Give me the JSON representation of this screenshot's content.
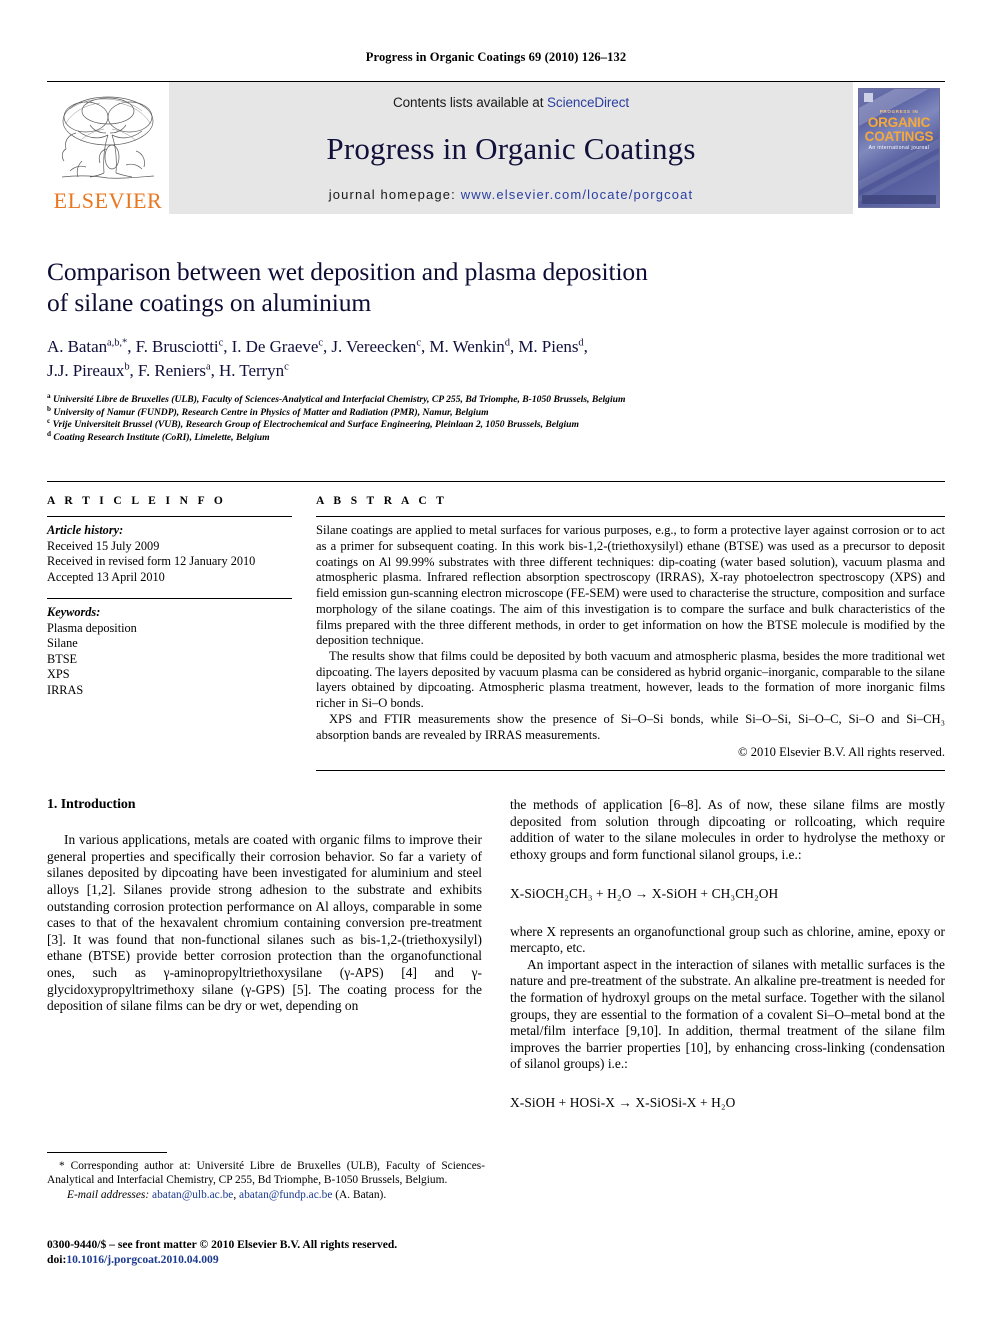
{
  "running_head": "Progress in Organic Coatings 69 (2010) 126–132",
  "masthead": {
    "publisher_name": "ELSEVIER",
    "contents_prefix": "Contents lists available at ",
    "contents_link": "ScienceDirect",
    "journal_title": "Progress in Organic Coatings",
    "homepage_prefix": "journal homepage: ",
    "homepage_url": "www.elsevier.com/locate/porgcoat",
    "cover": {
      "top_label": "PROGRESS IN",
      "line1": "ORGANIC",
      "line2": "COATINGS",
      "subtitle": "An international journal"
    },
    "link_color": "#2a3fa0",
    "elsevier_orange": "#E87722",
    "band_bg": "#e6e6e6"
  },
  "article": {
    "title_line1": "Comparison between wet deposition and plasma deposition",
    "title_line2": "of silane coatings on aluminium",
    "title_color": "#0c0c35",
    "authors": [
      {
        "name": "A. Batan",
        "sup": "a,b,*"
      },
      {
        "name": "F. Brusciotti",
        "sup": "c"
      },
      {
        "name": "I. De Graeve",
        "sup": "c"
      },
      {
        "name": "J. Vereecken",
        "sup": "c"
      },
      {
        "name": "M. Wenkin",
        "sup": "d"
      },
      {
        "name": "M. Piens",
        "sup": "d"
      },
      {
        "name": "J.J. Pireaux",
        "sup": "b"
      },
      {
        "name": "F. Reniers",
        "sup": "a"
      },
      {
        "name": "H. Terryn",
        "sup": "c"
      }
    ],
    "affiliations": [
      {
        "mark": "a",
        "text": "Université Libre de Bruxelles (ULB), Faculty of Sciences-Analytical and Interfacial Chemistry, CP 255, Bd Triomphe, B-1050 Brussels, Belgium"
      },
      {
        "mark": "b",
        "text": "University of Namur (FUNDP), Research Centre in Physics of Matter and Radiation (PMR), Namur, Belgium"
      },
      {
        "mark": "c",
        "text": "Vrije Universiteit Brussel (VUB), Research Group of Electrochemical and Surface Engineering, Pleinlaan 2, 1050 Brussels, Belgium"
      },
      {
        "mark": "d",
        "text": "Coating Research Institute (CoRI), Limelette, Belgium"
      }
    ]
  },
  "article_info": {
    "heading": "A R T I C L E   I N F O",
    "history_label": "Article history:",
    "history": [
      "Received 15 July 2009",
      "Received in revised form 12 January 2010",
      "Accepted 13 April 2010"
    ],
    "keywords_label": "Keywords:",
    "keywords": [
      "Plasma deposition",
      "Silane",
      "BTSE",
      "XPS",
      "IRRAS"
    ]
  },
  "abstract": {
    "heading": "A B S T R A C T",
    "paragraphs": [
      "Silane coatings are applied to metal surfaces for various purposes, e.g., to form a protective layer against corrosion or to act as a primer for subsequent coating. In this work bis-1,2-(triethoxysilyl) ethane (BTSE) was used as a precursor to deposit coatings on Al 99.99% substrates with three different techniques: dip-coating (water based solution), vacuum plasma and atmospheric plasma. Infrared reflection absorption spectroscopy (IRRAS), X-ray photoelectron spectroscopy (XPS) and field emission gun-scanning electron microscope (FE-SEM) were used to characterise the structure, composition and surface morphology of the silane coatings. The aim of this investigation is to compare the surface and bulk characteristics of the films prepared with the three different methods, in order to get information on how the BTSE molecule is modified by the deposition technique.",
      "The results show that films could be deposited by both vacuum and atmospheric plasma, besides the more traditional wet dipcoating. The layers deposited by vacuum plasma can be considered as hybrid organic–inorganic, comparable to the silane layers obtained by dipcoating. Atmospheric plasma treatment, however, leads to the formation of more inorganic films richer in Si–O bonds.",
      "XPS and FTIR measurements show the presence of Si–O–Si bonds, while Si–O–Si, Si–O–C, Si–O and Si–CH₃ absorption bands are revealed by IRRAS measurements."
    ],
    "copyright": "© 2010 Elsevier B.V. All rights reserved."
  },
  "introduction": {
    "section_number_title": "1. Introduction",
    "left_paragraph": "In various applications, metals are coated with organic films to improve their general properties and specifically their corrosion behavior. So far a variety of silanes deposited by dipcoating have been investigated for aluminium and steel alloys [1,2]. Silanes provide strong adhesion to the substrate and exhibits outstanding corrosion protection performance on Al alloys, comparable in some cases to that of the hexavalent chromium containing conversion pre-treatment [3]. It was found that non-functional silanes such as bis-1,2-(triethoxysilyl) ethane (BTSE) provide better corrosion protection than the organofunctional ones, such as γ-aminopropyltriethoxysilane (γ-APS) [4] and γ-glycidoxypropyltrimethoxy silane (γ-GPS) [5]. The coating process for the deposition of silane films can be dry or wet, depending on",
    "right_paragraph_1": "the methods of application [6–8]. As of now, these silane films are mostly deposited from solution through dipcoating or rollcoating, which require addition of water to the silane molecules in order to hydrolyse the methoxy or ethoxy groups and form functional silanol groups, i.e.:",
    "equation_1": "X-SiOCH₂CH₃ + H₂O  →  X-SiOH + CH₃CH₂OH",
    "right_paragraph_2": "where X represents an organofunctional group such as chlorine, amine, epoxy or mercapto, etc.",
    "right_paragraph_3": "An important aspect in the interaction of silanes with metallic surfaces is the nature and pre-treatment of the substrate. An alkaline pre-treatment is needed for the formation of hydroxyl groups on the metal surface. Together with the silanol groups, they are essential to the formation of a covalent Si–O–metal bond at the metal/film interface [9,10]. In addition, thermal treatment of the silane film improves the barrier properties [10], by enhancing cross-linking (condensation of silanol groups) i.e.:",
    "equation_2": "X-SiOH + HOSi-X  →  X-SiOSi-X + H₂O",
    "ref_color": "#1b3a8f"
  },
  "footer": {
    "corresponding_note": "* Corresponding author at: Université Libre de Bruxelles (ULB), Faculty of Sciences-Analytical and Interfacial Chemistry, CP 255, Bd Triomphe, B-1050 Brussels, Belgium.",
    "email_label": "E-mail addresses:",
    "email_1": "abatan@ulb.ac.be",
    "email_2": "abatan@fundp.ac.be",
    "email_attrib": "(A. Batan).",
    "issn_line": "0300-9440/$ – see front matter © 2010 Elsevier B.V. All rights reserved.",
    "doi_prefix": "doi:",
    "doi_value": "10.1016/j.porgcoat.2010.04.009"
  }
}
